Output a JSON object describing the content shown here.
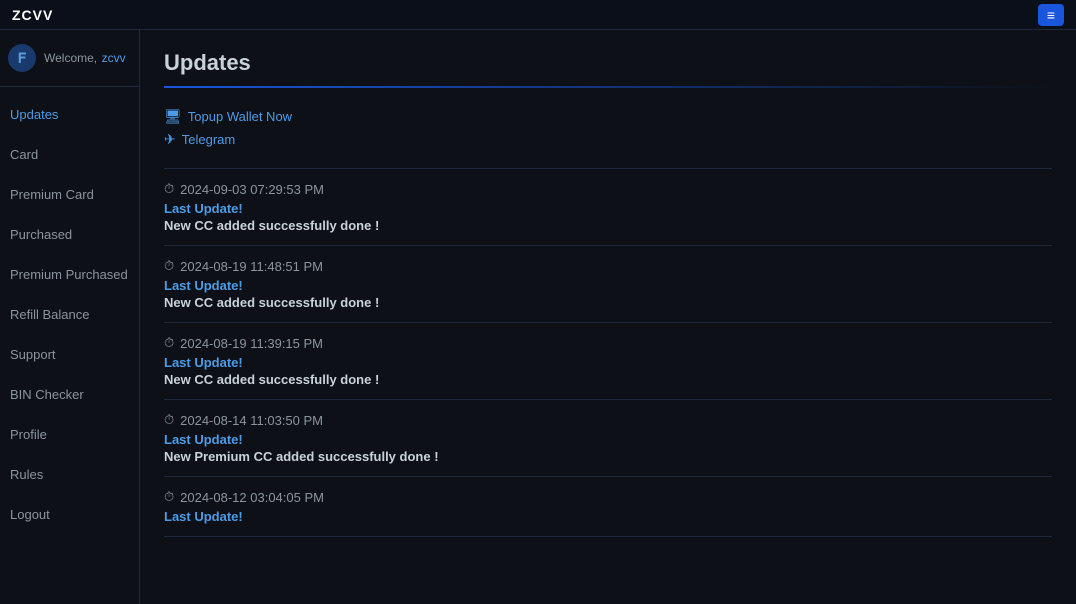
{
  "app": {
    "logo": "ZCVV",
    "menu_icon": "≡"
  },
  "sidebar": {
    "welcome_text": "Welcome,",
    "username": "zcvv",
    "user_icon": "F",
    "items": [
      {
        "label": "Updates",
        "active": true
      },
      {
        "label": "Card",
        "active": false
      },
      {
        "label": "Premium Card",
        "active": false
      },
      {
        "label": "Purchased",
        "active": false
      },
      {
        "label": "Premium Purchased",
        "active": false
      },
      {
        "label": "Refill Balance",
        "active": false
      },
      {
        "label": "Support",
        "active": false
      },
      {
        "label": "BIN Checker",
        "active": false
      },
      {
        "label": "Profile",
        "active": false
      },
      {
        "label": "Rules",
        "active": false
      },
      {
        "label": "Logout",
        "active": false
      }
    ]
  },
  "main": {
    "page_title": "Updates",
    "action_links": [
      {
        "icon": "🖥",
        "label": "Topup Wallet Now"
      },
      {
        "icon": "✈",
        "label": "Telegram"
      }
    ],
    "updates": [
      {
        "timestamp": "2024-09-03 07:29:53 PM",
        "label": "Last Update!",
        "message": "New CC added successfully done !"
      },
      {
        "timestamp": "2024-08-19 11:48:51 PM",
        "label": "Last Update!",
        "message": "New CC added successfully done !"
      },
      {
        "timestamp": "2024-08-19 11:39:15 PM",
        "label": "Last Update!",
        "message": "New CC added successfully done !"
      },
      {
        "timestamp": "2024-08-14 11:03:50 PM",
        "label": "Last Update!",
        "message": "New Premium CC added successfully done !"
      },
      {
        "timestamp": "2024-08-12 03:04:05 PM",
        "label": "Last Update!",
        "message": ""
      }
    ]
  }
}
